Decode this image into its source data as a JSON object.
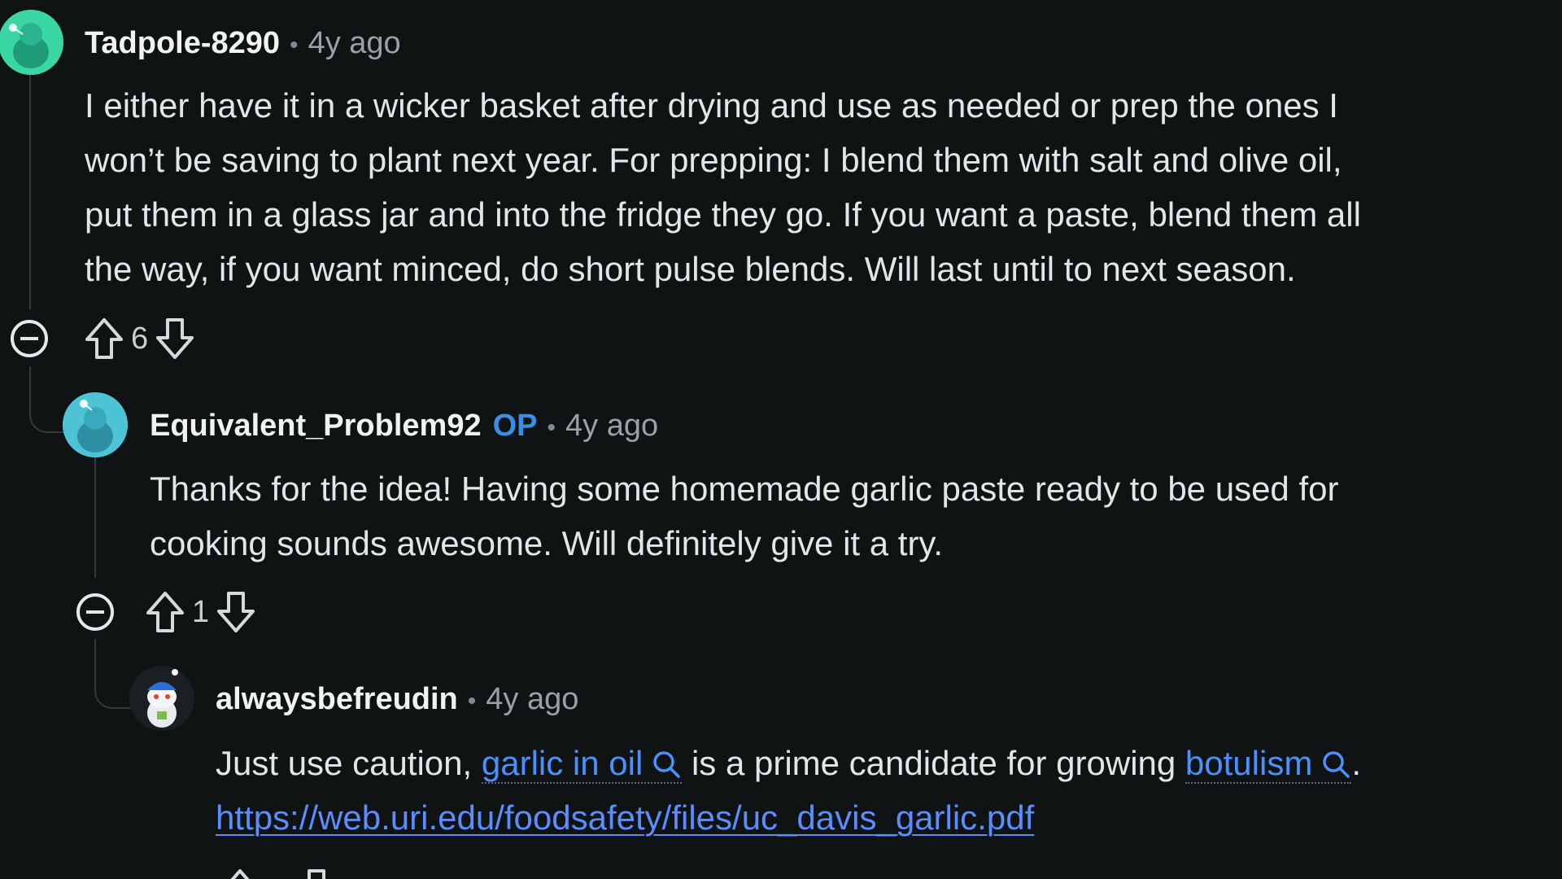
{
  "comments": [
    {
      "author": "Tadpole-8290",
      "time": "4y ago",
      "body": [
        "I either have it in a wicker basket after drying and use as needed or prep the ones I",
        "won’t be saving to plant next year. For prepping: I blend them with salt and olive oil,",
        "put them in a glass jar and into the fridge they go. If you want a paste, blend them all",
        "the way, if you want minced, do short pulse blends. Will last until to next season."
      ],
      "score": "6"
    },
    {
      "author": "Equivalent_Problem92",
      "op_badge": "OP",
      "time": "4y ago",
      "body": [
        "Thanks for the idea! Having some homemade garlic paste ready to be used for",
        "cooking sounds awesome. Will definitely give it a try."
      ],
      "score": "1"
    },
    {
      "author": "alwaysbefreudin",
      "time": "4y ago",
      "body_parts": {
        "prefix": "Just use caution, ",
        "link1": "garlic in oil",
        "middle": " is a prime candidate for growing ",
        "link2": "botulism",
        "suffix": "."
      },
      "url": "https://web.uri.edu/foodsafety/files/uc_davis_garlic.pdf"
    }
  ],
  "separator": "•",
  "icons": {
    "collapse": "collapse-minus-icon",
    "upvote": "upvote-arrow-icon",
    "downvote": "downvote-arrow-icon",
    "search": "search-icon"
  },
  "colors": {
    "background": "#0f1314",
    "op_badge": "#3a8fe3",
    "link": "#4a90ff",
    "avatar_green": "#3ad6a4",
    "avatar_teal": "#4fc3d6"
  }
}
